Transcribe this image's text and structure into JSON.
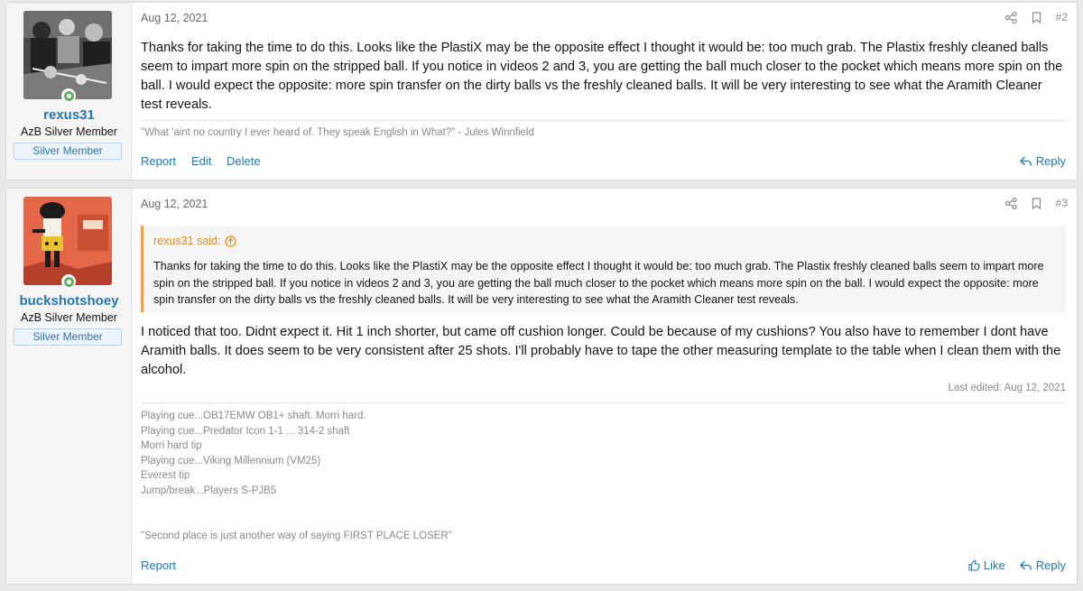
{
  "posts": [
    {
      "user": {
        "name": "rexus31",
        "title": "AzB Silver Member",
        "banner": "Silver Member"
      },
      "date": "Aug 12, 2021",
      "number": "#2",
      "body": "Thanks for taking the time to do this. Looks like the PlastiX may be the opposite effect I thought it would be: too much grab. The Plastix freshly cleaned balls seem to impart more spin on the stripped ball. If you notice in videos 2 and 3, you are getting the ball much closer to the pocket which means more spin on the ball. I would expect the opposite: more spin transfer on the dirty balls vs the freshly cleaned balls. It will be very interesting to see what the Aramith Cleaner test reveals.",
      "signature": "\"What 'aint no country I ever heard of. They speak English in What?\" - Jules Winnfield",
      "actions": {
        "report": "Report",
        "edit": "Edit",
        "delete": "Delete",
        "reply": "Reply"
      }
    },
    {
      "user": {
        "name": "buckshotshoey",
        "title": "AzB Silver Member",
        "banner": "Silver Member"
      },
      "date": "Aug 12, 2021",
      "number": "#3",
      "quote": {
        "author": "rexus31 said:",
        "body": "Thanks for taking the time to do this. Looks like the PlastiX may be the opposite effect I thought it would be: too much grab. The Plastix freshly cleaned balls seem to impart more spin on the stripped ball. If you notice in videos 2 and 3, you are getting the ball much closer to the pocket which means more spin on the ball. I would expect the opposite: more spin transfer on the dirty balls vs the freshly cleaned balls. It will be very interesting to see what the Aramith Cleaner test reveals."
      },
      "body": "I noticed that too. Didnt expect it. Hit 1 inch shorter, but came off cushion longer. Could be because of my cushions? You also have to remember I dont have Aramith balls. It does seem to be very consistent after 25 shots. I'll probably have to tape the other measuring template to the table when I clean them with the alcohol.",
      "last_edited": "Last edited: Aug 12, 2021",
      "signature_lines": [
        "Playing cue...OB17EMW OB1+ shaft. Morri hard.",
        "Playing cue...Predator Icon 1-1 ... 314-2 shaft",
        "Morri hard tip",
        "Playing cue...Viking Millennium (VM25)",
        "Everest tip",
        "Jump/break...Players S-PJB5"
      ],
      "signature_quote": "\"Second place is just another way of saying FIRST PLACE LOSER\"",
      "actions": {
        "report": "Report",
        "like": "Like",
        "reply": "Reply"
      }
    }
  ],
  "colors": {
    "link": "#2577b1",
    "quote_accent": "#f9a03f",
    "online": "#63b35f"
  },
  "icons": [
    "share-icon",
    "bookmark-icon",
    "reply-icon",
    "like-icon",
    "quote-arrow-icon",
    "online-status-icon"
  ]
}
